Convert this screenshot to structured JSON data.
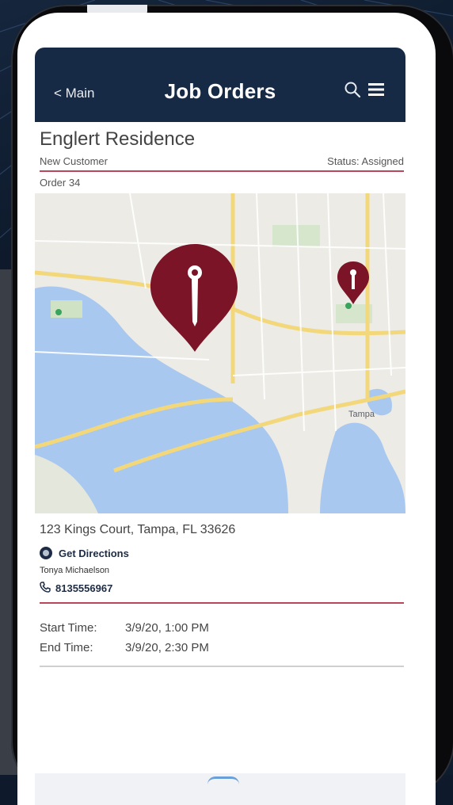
{
  "header": {
    "back_label": "< Main",
    "title": "Job Orders",
    "search_icon": "search-icon",
    "menu_icon": "hamburger-menu-icon"
  },
  "job": {
    "customer_name": "Englert Residence",
    "customer_type": "New Customer",
    "status": "Status: Assigned",
    "order": "Order 34",
    "address": "123 Kings Court, Tampa, FL 33626",
    "directions_label": "Get Directions",
    "contact_name": "Tonya Michaelson",
    "phone": "8135556967",
    "start_label": "Start Time:",
    "start_value": "3/9/20, 1:00 PM",
    "end_label": "End Time:",
    "end_value": "3/9/20, 2:30 PM"
  },
  "map": {
    "city_label": "Tampa",
    "pin_color": "#7a1426",
    "water_color": "#a9c8ef"
  },
  "colors": {
    "header_bg": "#172a45",
    "accent_rule": "#b9465b"
  }
}
